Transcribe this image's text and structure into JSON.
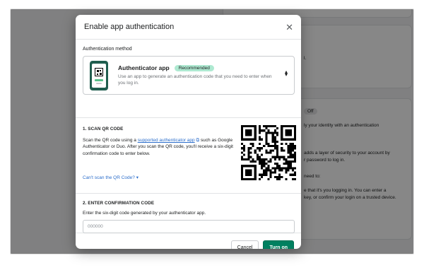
{
  "background": {
    "badge": "Off",
    "line1": "ly your identity with an authentication",
    "line2": "adds a layer of security to your account by",
    "line3": "r password to log in.",
    "line4": "need to:",
    "line5": "e that it's you logging in. You can enter a",
    "line6": "key, or confirm your login on a trusted device.",
    "fragment": "l."
  },
  "modal": {
    "title": "Enable app authentication",
    "close_icon": "close-icon",
    "method": {
      "label": "Authentication method",
      "selected_name": "Authenticator app",
      "badge": "Recommended",
      "description": "Use an app to generate an authentication code that you need to enter when you log in."
    },
    "scan": {
      "heading": "1. SCAN QR CODE",
      "text_before": "Scan the QR code using a ",
      "link_text": "supported authenticator app",
      "text_after": " such as Google Authenticator or Duo. After you scan the QR code, you'll receive a six-digit confirmation code to enter below.",
      "cant_scan": "Can't scan the QR Code?"
    },
    "confirm": {
      "heading": "2. ENTER CONFIRMATION CODE",
      "label": "Enter the six-digit code generated by your authenticator app.",
      "placeholder": "000000"
    },
    "footer": {
      "cancel": "Cancel",
      "submit": "Turn on"
    }
  },
  "colors": {
    "primary": "#008060",
    "link": "#2c6ecb",
    "badge": "#aee9d1"
  }
}
